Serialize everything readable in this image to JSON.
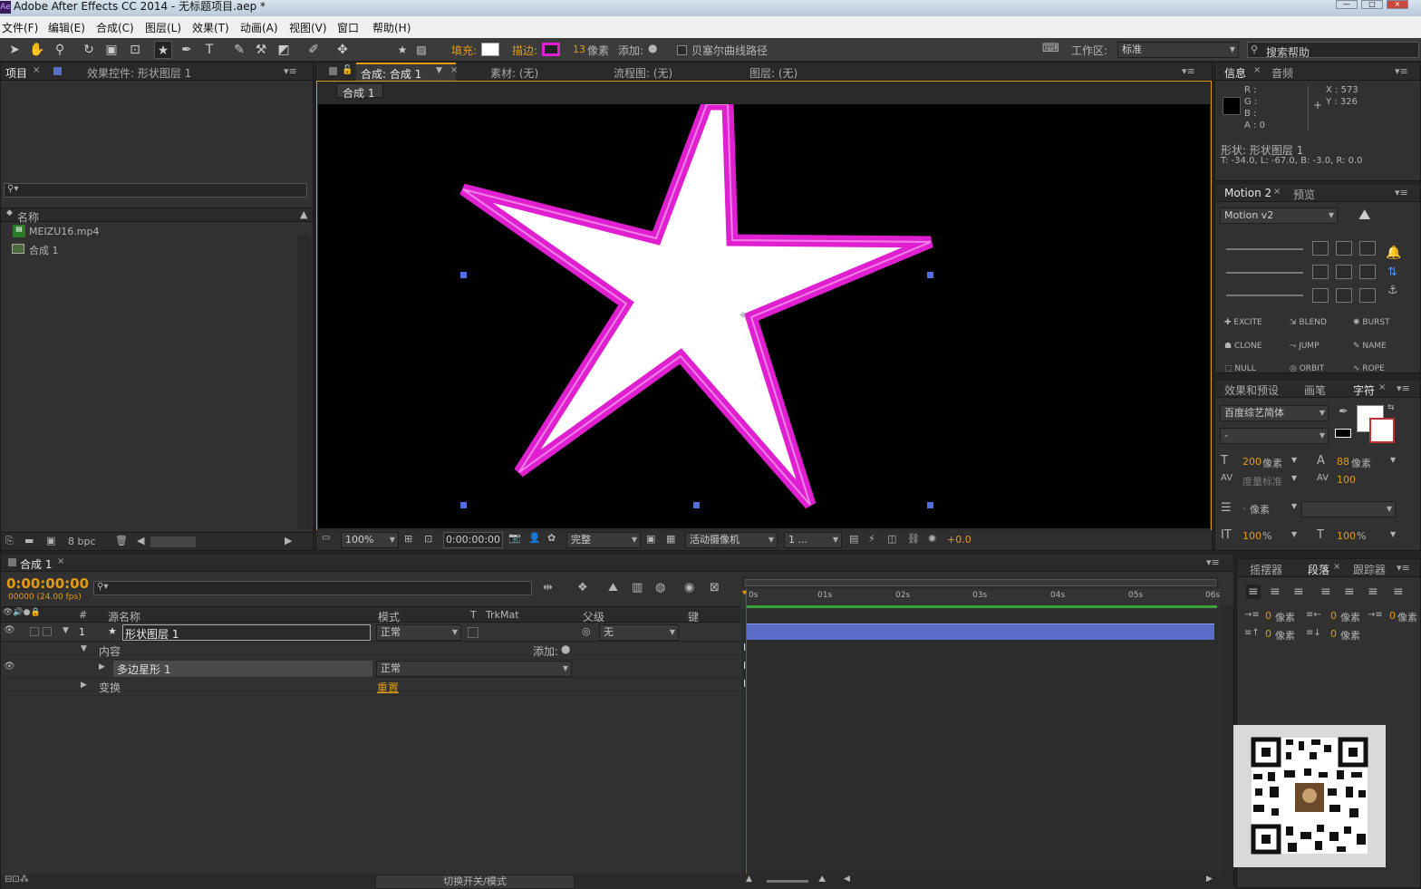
{
  "window": {
    "title": "Adobe After Effects CC 2014 - 无标题项目.aep *",
    "app_icon": "Ae"
  },
  "menu": [
    "文件(F)",
    "编辑(E)",
    "合成(C)",
    "图层(L)",
    "效果(T)",
    "动画(A)",
    "视图(V)",
    "窗口",
    "帮助(H)"
  ],
  "toolbar": {
    "fill_label": "填充:",
    "stroke_label": "描边:",
    "stroke_width": "13",
    "stroke_unit": "像素",
    "add_label": "添加:",
    "bezier_label": "贝塞尔曲线路径",
    "workspace_label": "工作区:",
    "workspace_value": "标准",
    "search_placeholder": "搜索帮助"
  },
  "project_panel": {
    "tab_project": "项目",
    "tab_effects": "效果控件: 形状图层 1",
    "col_name": "名称",
    "items": [
      {
        "name": "MEIZU16.mp4",
        "icon": "video-file-icon"
      },
      {
        "name": "合成 1",
        "icon": "composition-icon"
      }
    ],
    "bpc": "8 bpc"
  },
  "comp_panel": {
    "tab_comp": "合成: 合成 1",
    "tab_footage": "素材: (无)",
    "tab_flow": "流程图: (无)",
    "tab_layer": "图层: (无)",
    "breadcrumb": "合成 1",
    "zoom": "100%",
    "timecode": "0:00:00:00",
    "resolution": "完整",
    "camera": "活动摄像机",
    "views": "1 ...",
    "exposure": "+0.0"
  },
  "info_panel": {
    "tab_info": "信息",
    "tab_audio": "音频",
    "r": "R :",
    "g": "G :",
    "b": "B :",
    "a": "A : 0",
    "x": "X : 573",
    "y": "Y : 326",
    "shape_label": "形状: 形状图层 1",
    "bounds": "T: -34.0, L: -67.0, B: -3.0, R: 0.0"
  },
  "motion_panel": {
    "tab_motion": "Motion 2",
    "tab_preview": "预览",
    "preset": "Motion v2",
    "buttons": [
      "EXCITE",
      "BLEND",
      "BURST",
      "CLONE",
      "JUMP",
      "NAME",
      "NULL",
      "ORBIT",
      "ROPE"
    ]
  },
  "char_panel": {
    "tab_effects": "效果和预设",
    "tab_paint": "画笔",
    "tab_char": "字符",
    "font": "百度综艺简体",
    "style": "-",
    "size": "200",
    "size_unit": "像素",
    "leading": "88",
    "leading_unit": "像素",
    "kerning": "度量标准",
    "tracking": "100",
    "stroke_unit": "像素",
    "vscale": "100",
    "hscale": "100",
    "pct": "%"
  },
  "para_panel": {
    "tab_wiggler": "摇摆器",
    "tab_para": "段落",
    "tab_tracker": "跟踪器",
    "indent_vals": [
      "0",
      "0",
      "0",
      "0",
      "0"
    ],
    "unit": "像素"
  },
  "timeline": {
    "tab": "合成 1",
    "timecode": "0:00:00:00",
    "fps": "00000 (24.00 fps)",
    "col_num": "#",
    "col_source": "源名称",
    "col_mode": "模式",
    "col_t": "T",
    "col_trkmat": "TrkMat",
    "col_parent": "父级",
    "col_keys": "键",
    "layer": {
      "num": "1",
      "name": "形状图层 1",
      "mode": "正常",
      "parent": "无"
    },
    "contents": "内容",
    "add_label": "添加:",
    "polystar": "多边星形 1",
    "polystar_mode": "正常",
    "transform": "变换",
    "reset": "重置",
    "ruler": [
      "0s",
      "01s",
      "02s",
      "03s",
      "04s",
      "05s",
      "06s"
    ],
    "toggle_label": "切换开关/模式"
  },
  "colors": {
    "accent": "#e39a14",
    "stroke": "#e020d0",
    "layer_bar": "#5b6bc8",
    "handle": "#4f6fe0"
  }
}
